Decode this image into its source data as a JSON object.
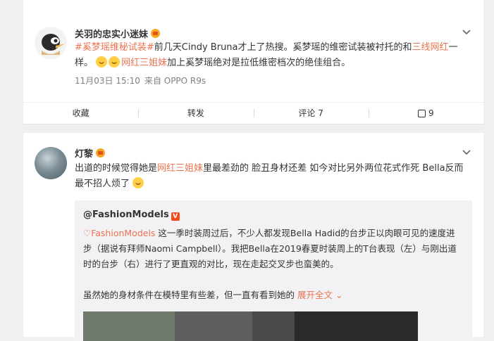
{
  "post1": {
    "username": "关羽的忠实小迷妹",
    "text_topic": "#奚梦瑶维秘试装#",
    "text_a": "前几天Cindy Bruna才上了热搜。奚梦瑶的维密试装被衬托的和",
    "text_hl1": "三线网红",
    "text_b": "一样。",
    "text_hl2": "网红三姐妹",
    "text_c": "加上奚梦瑶绝对是拉低维密档次的绝佳组合。",
    "date": "11月03日 15:10",
    "source": "来自 OPPO R9s",
    "actions": {
      "fav": "收藏",
      "repost": "转发",
      "comment": "评论 7",
      "like": "9"
    }
  },
  "post2": {
    "username": "灯黎",
    "text_a": "出道的时候觉得她是",
    "text_hl": "网红三姐妹",
    "text_b": "里最差劲的 脸丑身材还差 如今对比另外两位花式作死 Bella反而最不招人烦了",
    "repost": {
      "user": "@FashionModels",
      "link": "FashionModels",
      "text1": " 这一季时装周过后，不少人都发现Bella Hadid的台步正以肉眼可见的速度进步（据说有拜师Naomi Campbell）。我把Bella在2019春夏时装周上的T台表现（左）与刚出道时的台步（右）进行了更直观的对比，现在走起交叉步也蛮美的。",
      "text2": "虽然她的身材条件在模特里有些差，但一直有看到她的",
      "more": "展开全文"
    }
  },
  "icons": {
    "crown": "crown-badge-icon",
    "chevron": "chevron-down-icon",
    "like": "thumbs-up-icon",
    "verified": "verified-badge-icon"
  }
}
